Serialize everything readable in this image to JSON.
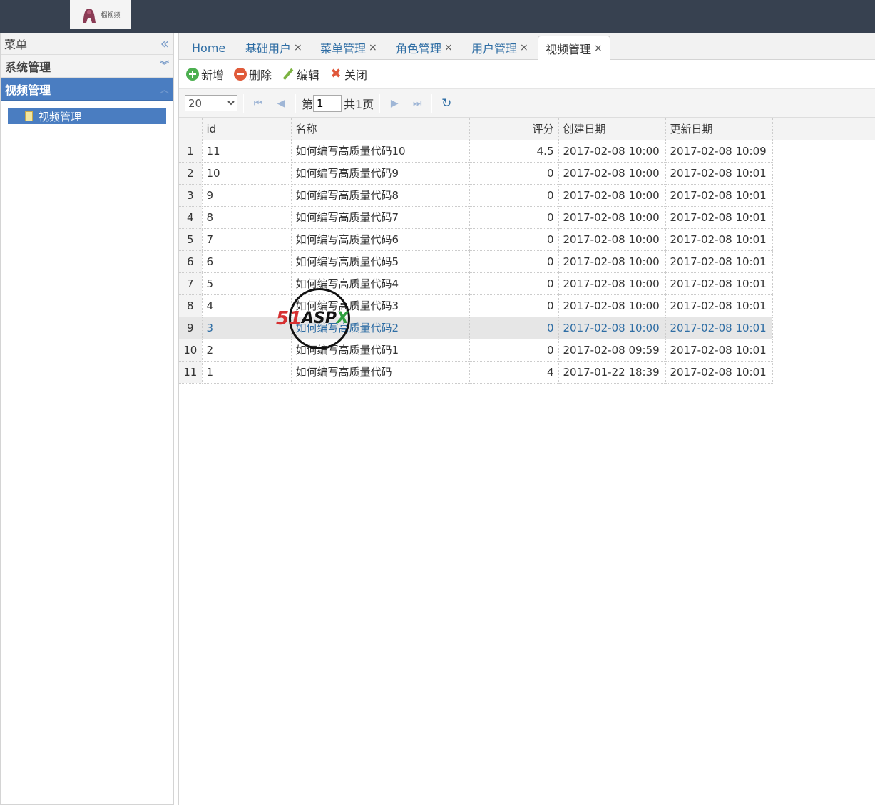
{
  "logo": {
    "text": "榴视频",
    "icon": "gorilla-logo-icon"
  },
  "west": {
    "title": "菜单",
    "collapse_icon": "double-chevron-left-icon",
    "sections": [
      {
        "label": "系统管理",
        "icon": "double-chevron-down-icon",
        "active": false
      },
      {
        "label": "视频管理",
        "icon": "chevron-up-icon",
        "active": true,
        "items": [
          {
            "label": "视频管理",
            "icon": "file-icon",
            "selected": true
          }
        ]
      }
    ]
  },
  "tabs": [
    {
      "label": "Home",
      "closable": false
    },
    {
      "label": "基础用户",
      "closable": true
    },
    {
      "label": "菜单管理",
      "closable": true
    },
    {
      "label": "角色管理",
      "closable": true
    },
    {
      "label": "用户管理",
      "closable": true
    },
    {
      "label": "视频管理",
      "closable": true,
      "active": true
    }
  ],
  "tab_close_glyph": "×",
  "toolbar": {
    "add": "新增",
    "delete": "删除",
    "edit": "编辑",
    "close": "关闭"
  },
  "pager": {
    "page_size": "20",
    "page_prefix": "第",
    "page_value": "1",
    "total_text": "共1页"
  },
  "grid": {
    "columns": [
      "id",
      "名称",
      "评分",
      "创建日期",
      "更新日期"
    ],
    "rows": [
      {
        "rn": "1",
        "id": "11",
        "name": "如何编写高质量代码10",
        "score": "4.5",
        "created": "2017-02-08 10:00",
        "updated": "2017-02-08 10:09"
      },
      {
        "rn": "2",
        "id": "10",
        "name": "如何编写高质量代码9",
        "score": "0",
        "created": "2017-02-08 10:00",
        "updated": "2017-02-08 10:01"
      },
      {
        "rn": "3",
        "id": "9",
        "name": "如何编写高质量代码8",
        "score": "0",
        "created": "2017-02-08 10:00",
        "updated": "2017-02-08 10:01"
      },
      {
        "rn": "4",
        "id": "8",
        "name": "如何编写高质量代码7",
        "score": "0",
        "created": "2017-02-08 10:00",
        "updated": "2017-02-08 10:01"
      },
      {
        "rn": "5",
        "id": "7",
        "name": "如何编写高质量代码6",
        "score": "0",
        "created": "2017-02-08 10:00",
        "updated": "2017-02-08 10:01"
      },
      {
        "rn": "6",
        "id": "6",
        "name": "如何编写高质量代码5",
        "score": "0",
        "created": "2017-02-08 10:00",
        "updated": "2017-02-08 10:01"
      },
      {
        "rn": "7",
        "id": "5",
        "name": "如何编写高质量代码4",
        "score": "0",
        "created": "2017-02-08 10:00",
        "updated": "2017-02-08 10:01"
      },
      {
        "rn": "8",
        "id": "4",
        "name": "如何编写高质量代码3",
        "score": "0",
        "created": "2017-02-08 10:00",
        "updated": "2017-02-08 10:01"
      },
      {
        "rn": "9",
        "id": "3",
        "name": "如何编写高质量代码2",
        "score": "0",
        "created": "2017-02-08 10:00",
        "updated": "2017-02-08 10:01",
        "highlighted": true
      },
      {
        "rn": "10",
        "id": "2",
        "name": "如何编写高质量代码1",
        "score": "0",
        "created": "2017-02-08 09:59",
        "updated": "2017-02-08 10:01"
      },
      {
        "rn": "11",
        "id": "1",
        "name": "如何编写高质量代码",
        "score": "4",
        "created": "2017-01-22 18:39",
        "updated": "2017-02-08 10:01"
      }
    ]
  },
  "watermark": {
    "text_51": "51",
    "text_asp": "ASP",
    "text_x": "X"
  }
}
